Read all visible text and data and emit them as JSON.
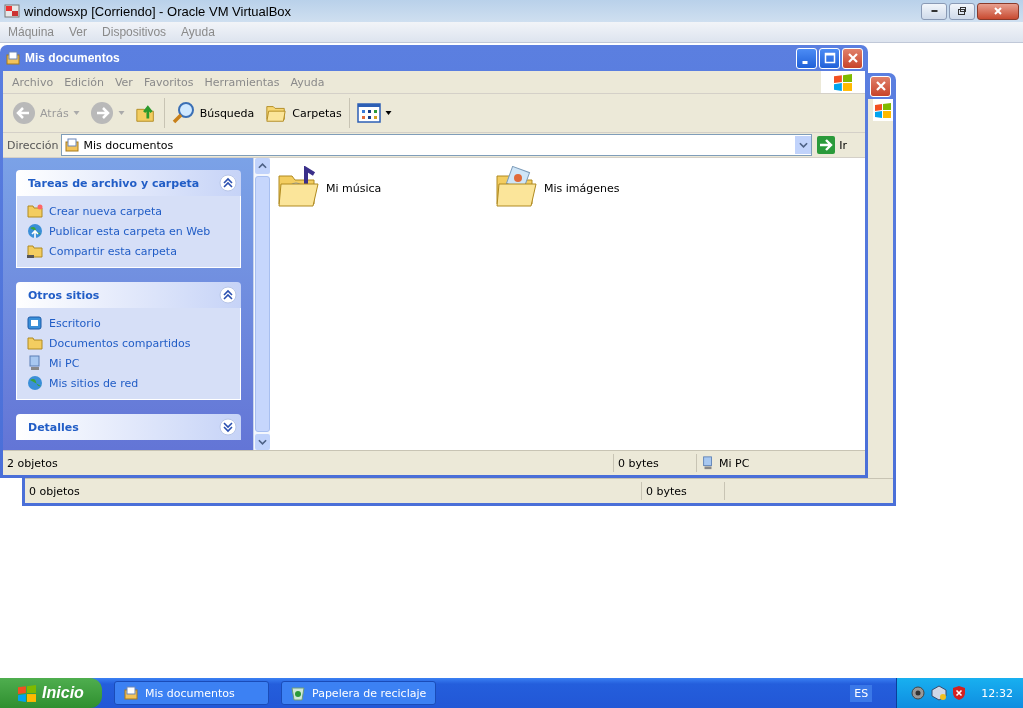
{
  "host": {
    "title": "windowsxp [Corriendo] - Oracle VM VirtualBox",
    "menu": [
      "Máquina",
      "Ver",
      "Dispositivos",
      "Ayuda"
    ]
  },
  "back_window": {
    "status_bar": [
      "0 objetos",
      "0 bytes"
    ]
  },
  "window": {
    "title": "Mis documentos",
    "menu": [
      "Archivo",
      "Edición",
      "Ver",
      "Favoritos",
      "Herramientas",
      "Ayuda"
    ],
    "toolbar": [
      {
        "kind": "back",
        "label": "Atrás",
        "disabled": true
      },
      {
        "kind": "forward",
        "disabled": true
      },
      {
        "kind": "up"
      },
      {
        "kind": "search",
        "label": "Búsqueda"
      },
      {
        "kind": "folders",
        "label": "Carpetas"
      },
      {
        "kind": "views"
      }
    ],
    "address": {
      "label": "Dirección",
      "value": "Mis documentos",
      "go": "Ir"
    },
    "panels": [
      {
        "title": "Tareas de archivo y carpeta",
        "expanded": true,
        "items": [
          {
            "kind": "new-folder",
            "label": "Crear nueva carpeta"
          },
          {
            "kind": "publish",
            "label": "Publicar esta carpeta en Web"
          },
          {
            "kind": "share",
            "label": "Compartir esta carpeta"
          }
        ]
      },
      {
        "title": "Otros sitios",
        "expanded": true,
        "items": [
          {
            "kind": "desktop",
            "label": "Escritorio"
          },
          {
            "kind": "folder",
            "label": "Documentos compartidos"
          },
          {
            "kind": "computer",
            "label": "Mi PC"
          },
          {
            "kind": "network",
            "label": "Mis sitios de red"
          }
        ]
      },
      {
        "title": "Detalles",
        "expanded": false
      }
    ],
    "files": [
      {
        "kind": "music",
        "label": "Mi música"
      },
      {
        "kind": "pictures",
        "label": "Mis imágenes"
      }
    ],
    "status_bar": {
      "objects": "2 objetos",
      "size": "0 bytes",
      "zone": "Mi PC"
    }
  },
  "taskbar": {
    "start": "Inicio",
    "tasks": [
      {
        "kind": "documents",
        "label": "Mis documentos",
        "selected": false
      },
      {
        "kind": "recycle",
        "label": "Papelera de reciclaje",
        "selected": false
      }
    ],
    "language": "ES",
    "clock": "12:32"
  }
}
